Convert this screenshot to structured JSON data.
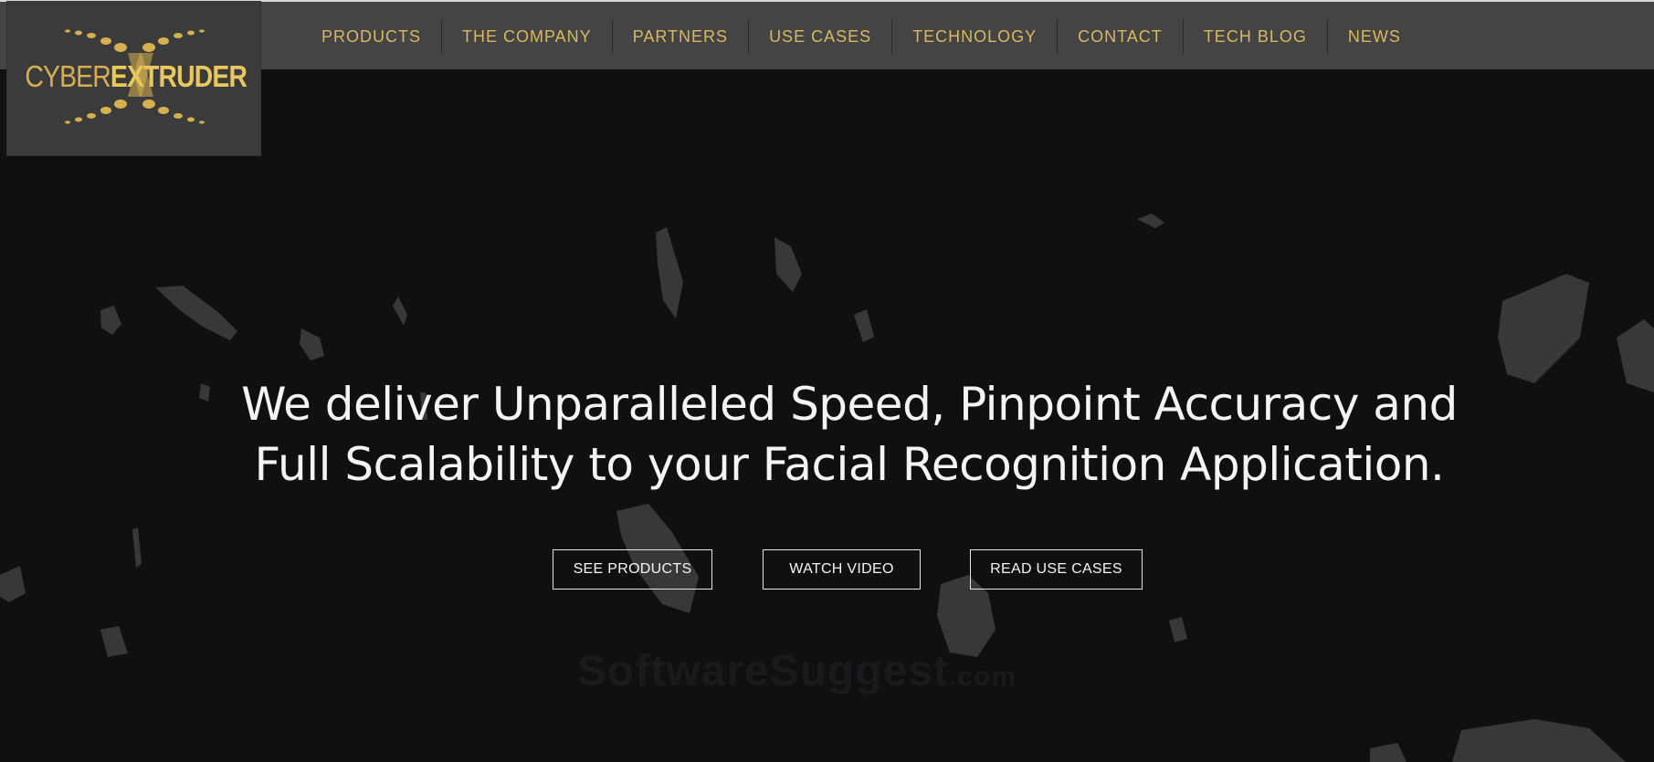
{
  "brand": {
    "name_part1": "CYBER",
    "name_part2": "EXTRUDER",
    "logo_icon": "cyber-extruder-dots-logo"
  },
  "nav": {
    "items": [
      {
        "label": "PRODUCTS"
      },
      {
        "label": "THE COMPANY"
      },
      {
        "label": "PARTNERS"
      },
      {
        "label": "USE CASES"
      },
      {
        "label": "TECHNOLOGY"
      },
      {
        "label": "CONTACT"
      },
      {
        "label": "TECH BLOG"
      },
      {
        "label": "NEWS"
      }
    ]
  },
  "hero": {
    "headline_line1": "We deliver Unparalleled Speed, Pinpoint Accuracy and",
    "headline_line2": "Full Scalability to your Facial Recognition Application.",
    "buttons": {
      "see_products": "SEE PRODUCTS",
      "watch_video": "WATCH VIDEO",
      "read_use_cases": "READ USE CASES"
    }
  },
  "watermark": {
    "text": "SoftwareSuggest",
    "suffix": ".com"
  },
  "colors": {
    "accent_gold": "#d8b860",
    "topbar_bg": "#444444",
    "page_bg": "#101011",
    "text_light": "#f4f4f4"
  }
}
